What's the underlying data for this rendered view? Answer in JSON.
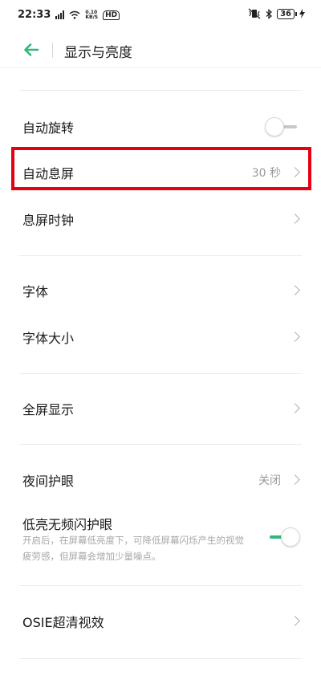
{
  "status_bar": {
    "time": "22:33",
    "network_speed": "0.10",
    "network_unit": "KB/S",
    "hd": "HD",
    "battery": "36"
  },
  "header": {
    "title": "显示与亮度"
  },
  "items": {
    "auto_rotate": {
      "label": "自动旋转",
      "enabled": false
    },
    "auto_lock": {
      "label": "自动息屏",
      "value": "30 秒"
    },
    "screen_off_clock": {
      "label": "息屏时钟"
    },
    "font": {
      "label": "字体"
    },
    "font_size": {
      "label": "字体大小"
    },
    "fullscreen": {
      "label": "全屏显示"
    },
    "night_mode": {
      "label": "夜间护眼",
      "value": "关闭"
    },
    "low_brightness_eye": {
      "label": "低亮无频闪护眼",
      "enabled": true,
      "description": "开启后，在屏幕低亮度下，可降低屏幕闪烁产生的视觉疲劳感，但屏幕会增加少量噪点。"
    },
    "osie": {
      "label": "OSIE超清视效"
    }
  },
  "colors": {
    "accent": "#2db87d",
    "highlight": "#e50012"
  }
}
